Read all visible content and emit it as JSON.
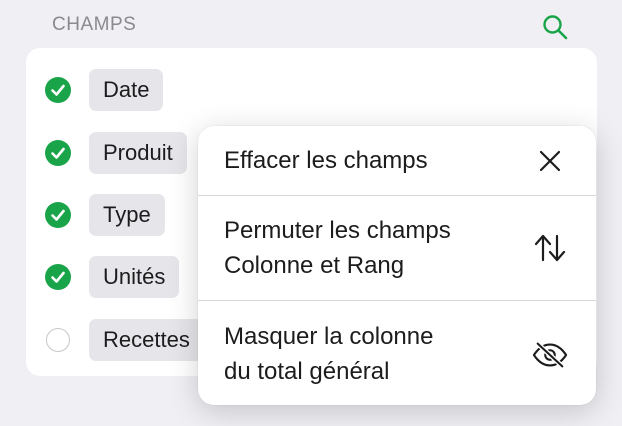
{
  "header": {
    "title": "CHAMPS",
    "search_icon": "search-icon"
  },
  "colors": {
    "accent": "#1aa44a",
    "background": "#efeff4",
    "chip": "#e6e6ea"
  },
  "fields": [
    {
      "label": "Date",
      "checked": true
    },
    {
      "label": "Produit",
      "checked": true
    },
    {
      "label": "Type",
      "checked": true
    },
    {
      "label": "Unités",
      "checked": true
    },
    {
      "label": "Recettes",
      "checked": false
    }
  ],
  "menu": {
    "items": [
      {
        "label_lines": [
          "Effacer les champs"
        ],
        "icon": "close-icon"
      },
      {
        "label_lines": [
          "Permuter les champs",
          "Colonne et Rang"
        ],
        "icon": "swap-arrows-icon"
      },
      {
        "label_lines": [
          "Masquer la colonne",
          "du total général"
        ],
        "icon": "eye-slash-icon"
      }
    ]
  }
}
